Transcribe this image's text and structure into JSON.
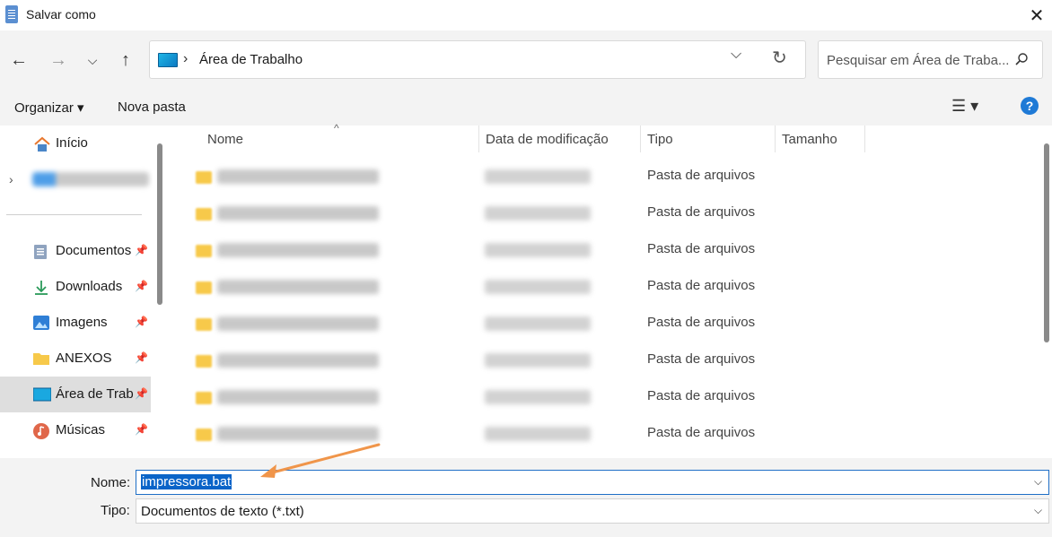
{
  "window": {
    "title": "Salvar como",
    "close_glyph": "✕"
  },
  "nav": {
    "address": "Área de Trabalho",
    "search_placeholder": "Pesquisar em Área de Traba..."
  },
  "toolbar": {
    "organize": "Organizar ▾",
    "new_folder": "Nova pasta",
    "view_glyph": "☰ ▾",
    "help_glyph": "?"
  },
  "sidebar": {
    "items": [
      {
        "label": "Início",
        "icon": "home-icon",
        "pinned": false
      },
      {
        "label": "Documentos",
        "icon": "documents-icon",
        "pinned": true
      },
      {
        "label": "Downloads",
        "icon": "downloads-icon",
        "pinned": true
      },
      {
        "label": "Imagens",
        "icon": "pictures-icon",
        "pinned": true
      },
      {
        "label": "ANEXOS",
        "icon": "folder-icon",
        "pinned": true
      },
      {
        "label": "Área de Trab",
        "icon": "desktop-icon",
        "pinned": true,
        "selected": true
      },
      {
        "label": "Músicas",
        "icon": "music-icon",
        "pinned": true
      }
    ]
  },
  "list": {
    "columns": [
      "Nome",
      "Data de modificação",
      "Tipo",
      "Tamanho"
    ],
    "rows": [
      {
        "type": "Pasta de arquivos"
      },
      {
        "type": "Pasta de arquivos"
      },
      {
        "type": "Pasta de arquivos"
      },
      {
        "type": "Pasta de arquivos"
      },
      {
        "type": "Pasta de arquivos"
      },
      {
        "type": "Pasta de arquivos"
      },
      {
        "type": "Pasta de arquivos"
      },
      {
        "type": "Pasta de arquivos"
      }
    ]
  },
  "form": {
    "name_label": "Nome:",
    "name_value": "impressora.bat",
    "type_label": "Tipo:",
    "type_value": "Documentos de texto (*.txt)"
  },
  "colors": {
    "accent": "#0a64c8",
    "annotation_arrow": "#f0954a",
    "folder": "#f7c94a"
  }
}
